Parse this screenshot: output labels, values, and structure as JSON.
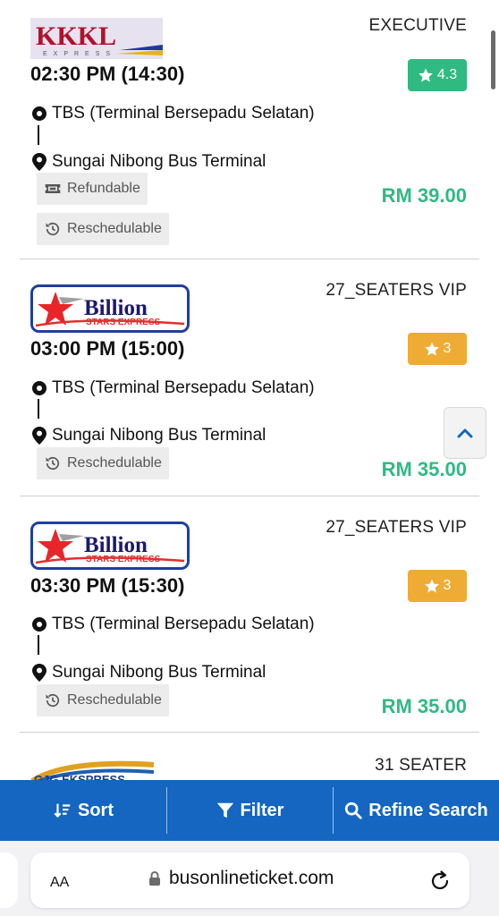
{
  "cards": [
    {
      "operator": "KKKL Express",
      "logo_text": "KKKL",
      "logo_sub": "EXPRESS",
      "bus_type": "EXECUTIVE",
      "departure": "02:30 PM (14:30)",
      "rating": "4.3",
      "rating_color": "#2fba82",
      "from": "TBS (Terminal Bersepadu Selatan)",
      "to": "Sungai Nibong Bus Terminal",
      "tags": [
        "Refundable",
        "Reschedulable"
      ],
      "price": "RM 39.00"
    },
    {
      "operator": "Billion Stars Express",
      "logo_text": "Billion",
      "logo_sub": "STARS EXPRESS",
      "bus_type": "27_SEATERS VIP",
      "departure": "03:00 PM (15:00)",
      "rating": "3",
      "rating_color": "#eeac35",
      "from": "TBS (Terminal Bersepadu Selatan)",
      "to": "Sungai Nibong Bus Terminal",
      "tags": [
        "Reschedulable"
      ],
      "price": "RM 35.00"
    },
    {
      "operator": "Billion Stars Express",
      "logo_text": "Billion",
      "logo_sub": "STARS EXPRESS",
      "bus_type": "27_SEATERS VIP",
      "departure": "03:30 PM (15:30)",
      "rating": "3",
      "rating_color": "#eeac35",
      "from": "TBS (Terminal Bersepadu Selatan)",
      "to": "Sungai Nibong Bus Terminal",
      "tags": [
        "Reschedulable"
      ],
      "price": "RM 35.00"
    },
    {
      "operator": "GJG Ekspress",
      "logo_text": "GJG EKSPRESS",
      "bus_type": "31 SEATER"
    }
  ],
  "action_bar": {
    "sort": "Sort",
    "filter": "Filter",
    "refine": "Refine Search"
  },
  "browser": {
    "aa": "AA",
    "url": "busonlineticket.com"
  },
  "icons": {
    "star": "star-icon",
    "origin": "origin-dot-icon",
    "destination": "map-pin-icon",
    "refundable": "ticket-icon",
    "reschedulable": "history-icon",
    "scroll_top": "chevron-up-icon",
    "sort": "sort-icon",
    "filter": "filter-icon",
    "search": "search-icon",
    "lock": "lock-icon",
    "reload": "reload-icon"
  },
  "colors": {
    "primary": "#1466c0",
    "price": "#2fba82",
    "rating_high": "#2fba82",
    "rating_mid": "#eeac35"
  }
}
